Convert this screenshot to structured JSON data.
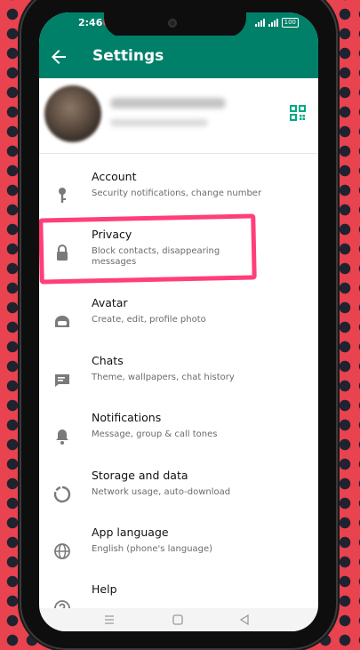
{
  "status_bar": {
    "time": "2:46",
    "battery": "100"
  },
  "app_bar": {
    "title": "Settings"
  },
  "profile": {
    "name": "",
    "status": ""
  },
  "settings_items": [
    {
      "id": "account",
      "label": "Account",
      "desc": "Security notifications, change number",
      "icon": "key-icon"
    },
    {
      "id": "privacy",
      "label": "Privacy",
      "desc": "Block contacts, disappearing messages",
      "icon": "lock-icon"
    },
    {
      "id": "avatar",
      "label": "Avatar",
      "desc": "Create, edit, profile photo",
      "icon": "avatar-face-icon"
    },
    {
      "id": "chats",
      "label": "Chats",
      "desc": "Theme, wallpapers, chat history",
      "icon": "chat-icon"
    },
    {
      "id": "notifications",
      "label": "Notifications",
      "desc": "Message, group & call tones",
      "icon": "bell-icon"
    },
    {
      "id": "storage",
      "label": "Storage and data",
      "desc": "Network usage, auto-download",
      "icon": "storage-circle-icon"
    },
    {
      "id": "language",
      "label": "App language",
      "desc": "English (phone's language)",
      "icon": "globe-icon"
    },
    {
      "id": "help",
      "label": "Help",
      "desc": "",
      "icon": "help-icon"
    }
  ],
  "colors": {
    "brand": "#008069",
    "highlight": "#ff3e7a",
    "icon": "#7a7a7a",
    "qr": "#00a884"
  }
}
